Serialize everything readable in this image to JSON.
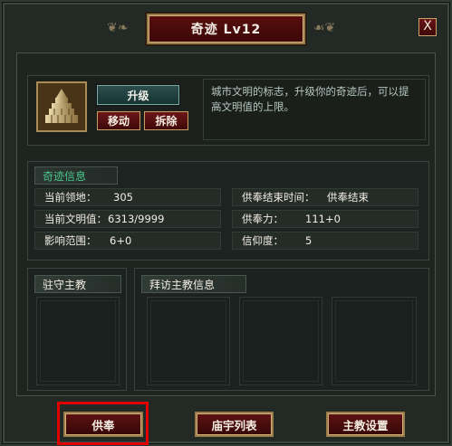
{
  "title": "奇迹  Lv12",
  "close_label": "X",
  "buttons": {
    "upgrade": "升级",
    "move": "移动",
    "demolish": "拆除"
  },
  "description": "城市文明的标志，升级你的奇迹后，可以提高文明值的上限。",
  "info": {
    "section_label": "奇迹信息",
    "rows": [
      {
        "label": "当前领地：",
        "value": "305"
      },
      {
        "label": "当前文明值：",
        "value": "6313/9999"
      },
      {
        "label": "影响范围：",
        "value": "6+0"
      },
      {
        "label": "供奉结束时间：",
        "value": "供奉结束"
      },
      {
        "label": "供奉力：",
        "value": "111+0"
      },
      {
        "label": "信仰度：",
        "value": "5"
      }
    ]
  },
  "garrison": {
    "label": "驻守主教"
  },
  "visiting": {
    "label": "拜访主教信息"
  },
  "footer": {
    "offering": "供奉",
    "temple_list": "庙宇列表",
    "bishop_settings": "主教设置"
  },
  "colors": {
    "accent_red": "#e00000",
    "section_green": "#46c88a",
    "title_bg": "#4a0a0a"
  }
}
